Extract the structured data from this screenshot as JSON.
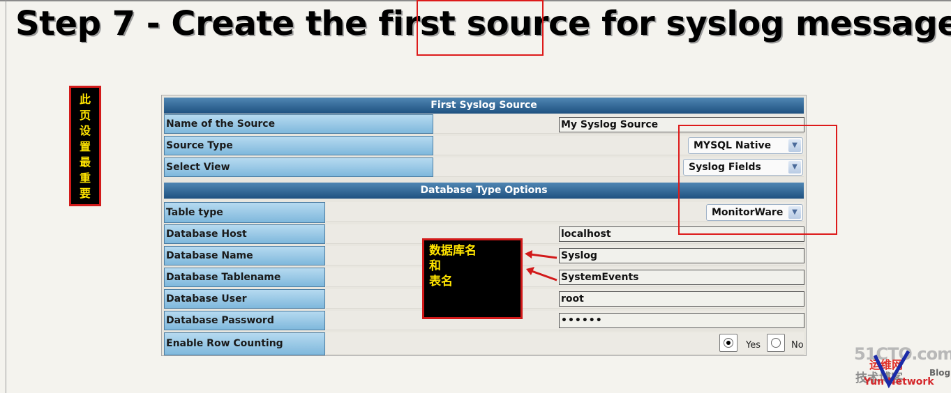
{
  "title": {
    "prefix": "Step 7 - Create the first ",
    "highlight": "source",
    "suffix": " for syslog messages"
  },
  "annotation_vertical": [
    "此",
    "页",
    "设",
    "置",
    "最",
    "重",
    "要"
  ],
  "form": {
    "sections": {
      "first_source": "First Syslog Source",
      "db_options": "Database Type Options"
    },
    "fields": {
      "name": {
        "label": "Name of the Source",
        "value": "My Syslog Source"
      },
      "source_type": {
        "label": "Source Type",
        "value": "MYSQL Native"
      },
      "select_view": {
        "label": "Select View",
        "value": "Syslog Fields"
      },
      "table_type": {
        "label": "Table type",
        "value": "MonitorWare"
      },
      "db_host": {
        "label": "Database Host",
        "value": "localhost"
      },
      "db_name": {
        "label": "Database Name",
        "value": "Syslog"
      },
      "db_tablename": {
        "label": "Database Tablename",
        "value": "SystemEvents"
      },
      "db_user": {
        "label": "Database User",
        "value": "root"
      },
      "db_password": {
        "label": "Database Password",
        "value": "••••••"
      },
      "row_counting": {
        "label": "Enable Row Counting",
        "yes": "Yes",
        "no": "No",
        "selected": "Yes"
      }
    }
  },
  "callout": {
    "line1": "数据库名",
    "line2": "和",
    "line3": "表名"
  },
  "watermark": {
    "site": "51CTO.com",
    "cn_top": "运维网",
    "cn_bottom": "技术博客",
    "blog": "Blog",
    "network": "Yun Network"
  },
  "colors": {
    "accent_red": "#dd1a1a",
    "header_blue": "#1f5180",
    "label_blue": "#9ccbe9",
    "note_yellow": "#ffe400"
  },
  "icons": [
    "chevron-down-icon",
    "arrow-left-icon"
  ]
}
